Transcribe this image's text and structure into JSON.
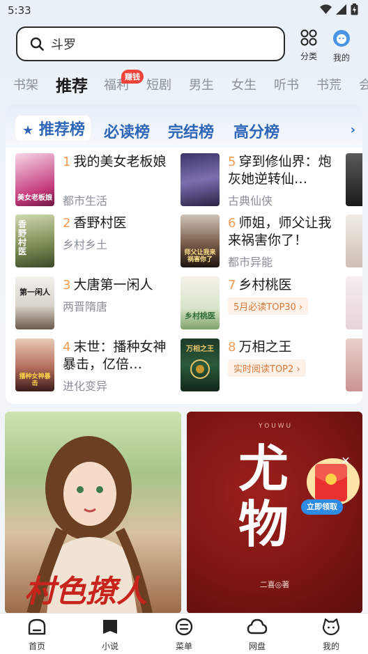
{
  "status": {
    "time": "5:33"
  },
  "search": {
    "query": "斗罗"
  },
  "top_actions": [
    {
      "label": "分类",
      "icon": "grid-icon"
    },
    {
      "label": "我的",
      "icon": "avatar-icon"
    }
  ],
  "tabs": [
    "书架",
    "推荐",
    "福利",
    "短剧",
    "男生",
    "女生",
    "听书",
    "书荒",
    "会"
  ],
  "badge": "赚钱",
  "rank_tabs": [
    "推荐榜",
    "必读榜",
    "完结榜",
    "高分榜"
  ],
  "books": [
    {
      "rank": "1",
      "title": "我的美女老板娘",
      "meta": "都市生活"
    },
    {
      "rank": "2",
      "title": "香野村医",
      "meta": "乡村乡土"
    },
    {
      "rank": "3",
      "title": "大唐第一闲人",
      "meta": "两晋隋唐"
    },
    {
      "rank": "4",
      "title": "末世：播种女神暴击，亿倍…",
      "meta": "进化变异"
    },
    {
      "rank": "5",
      "title": "穿到修仙界：炮灰她逆转仙…",
      "meta": "古典仙侠"
    },
    {
      "rank": "6",
      "title": "师姐，师父让我来祸害你了！",
      "meta": "都市异能"
    },
    {
      "rank": "7",
      "title": "乡村桃医",
      "meta": "5月必读TOP30"
    },
    {
      "rank": "8",
      "title": "万相之王",
      "meta": "实时阅读TOP2"
    }
  ],
  "cover_texts": [
    "美女老板娘",
    "香野村医",
    "第一闲人",
    "播种女神暴击",
    "",
    "师父让我来祸害你了",
    "乡村桃医",
    "万相之王"
  ],
  "banners": [
    {
      "title": "村色撩人"
    },
    {
      "title": "尤物",
      "author": "二喜◎著",
      "header": "Y O U W U"
    }
  ],
  "popup": {
    "button": "立即领取",
    "close": "✕"
  },
  "bottom_nav": [
    {
      "label": "首页",
      "icon": "home-icon"
    },
    {
      "label": "小说",
      "icon": "book-icon"
    },
    {
      "label": "菜单",
      "icon": "menu-icon"
    },
    {
      "label": "网盘",
      "icon": "cloud-icon"
    },
    {
      "label": "我的",
      "icon": "profile-icon"
    }
  ],
  "colors": {
    "accent": "#2f66b8",
    "rank_number": "#f29b54",
    "badge": "#f0433a"
  }
}
